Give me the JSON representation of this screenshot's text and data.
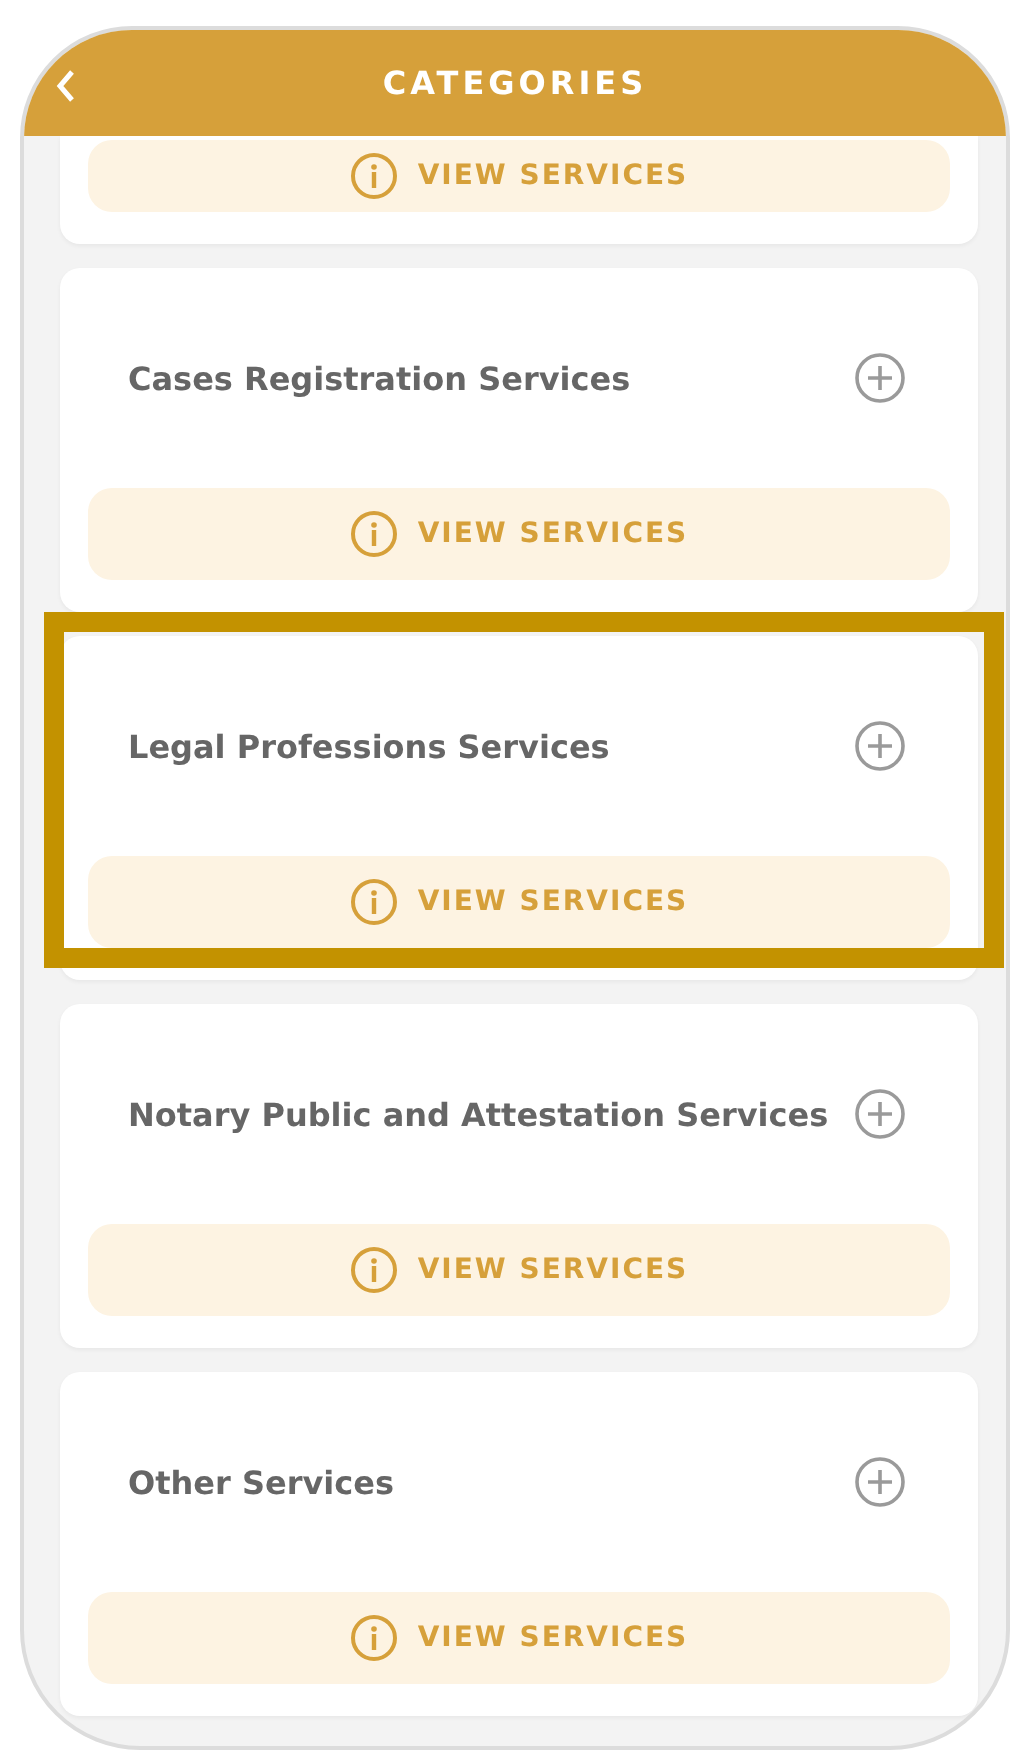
{
  "header": {
    "title": "CATEGORIES"
  },
  "partial_card": {
    "button": "VIEW SERVICES"
  },
  "categories": [
    {
      "title": "Cases Registration Services",
      "button": "VIEW SERVICES",
      "highlighted": false
    },
    {
      "title": "Legal Professions Services",
      "button": "VIEW SERVICES",
      "highlighted": true
    },
    {
      "title": "Notary Public and Attestation Services",
      "button": "VIEW SERVICES",
      "highlighted": false
    },
    {
      "title": "Other Services",
      "button": "VIEW SERVICES",
      "highlighted": false
    }
  ]
}
